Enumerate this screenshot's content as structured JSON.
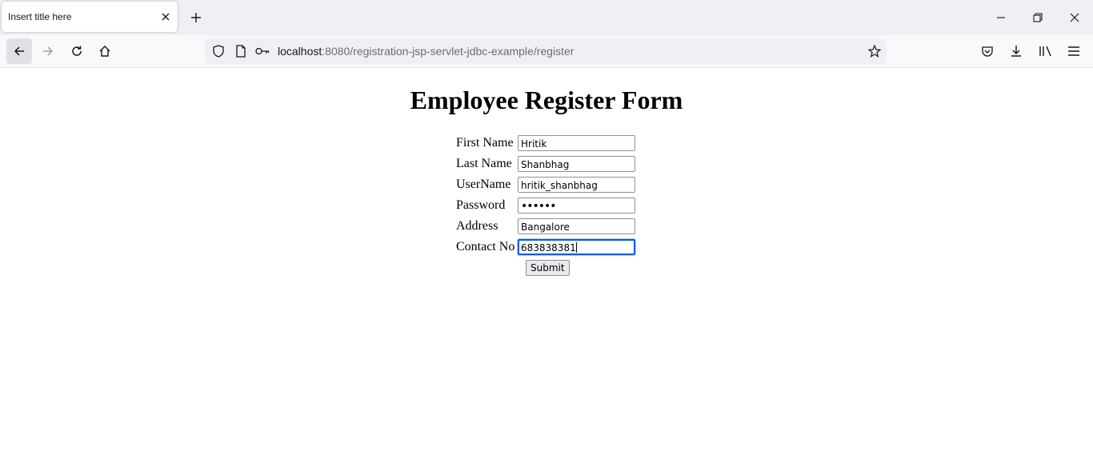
{
  "browser": {
    "tab_title": "Insert title here",
    "url_host": "localhost",
    "url_rest": ":8080/registration-jsp-servlet-jdbc-example/register"
  },
  "icons": {
    "tab_close": "close-icon",
    "new_tab": "plus-icon",
    "minimize": "minimize-icon",
    "restore": "restore-icon",
    "close_window": "close-icon",
    "back": "arrow-left-icon",
    "forward": "arrow-right-icon",
    "reload": "reload-icon",
    "home": "home-icon",
    "shield": "shield-icon",
    "page": "page-icon",
    "key": "key-icon",
    "bookmark": "star-icon",
    "pocket": "pocket-icon",
    "downloads": "download-icon",
    "library": "library-icon",
    "menu": "hamburger-icon"
  },
  "page": {
    "title": "Employee Register Form",
    "fields": [
      {
        "label": "First Name",
        "value": "Hritik"
      },
      {
        "label": "Last Name",
        "value": "Shanbhag"
      },
      {
        "label": "UserName",
        "value": "hritik_shanbhag"
      },
      {
        "label": "Password",
        "value": "••••••"
      },
      {
        "label": "Address",
        "value": "Bangalore"
      },
      {
        "label": "Contact No",
        "value": "683838381"
      }
    ],
    "submit_label": "Submit"
  },
  "colors": {
    "focus_ring": "#0060df",
    "tabstrip_bg": "#f0f0f4",
    "navbar_bg": "#f9f9fb"
  }
}
